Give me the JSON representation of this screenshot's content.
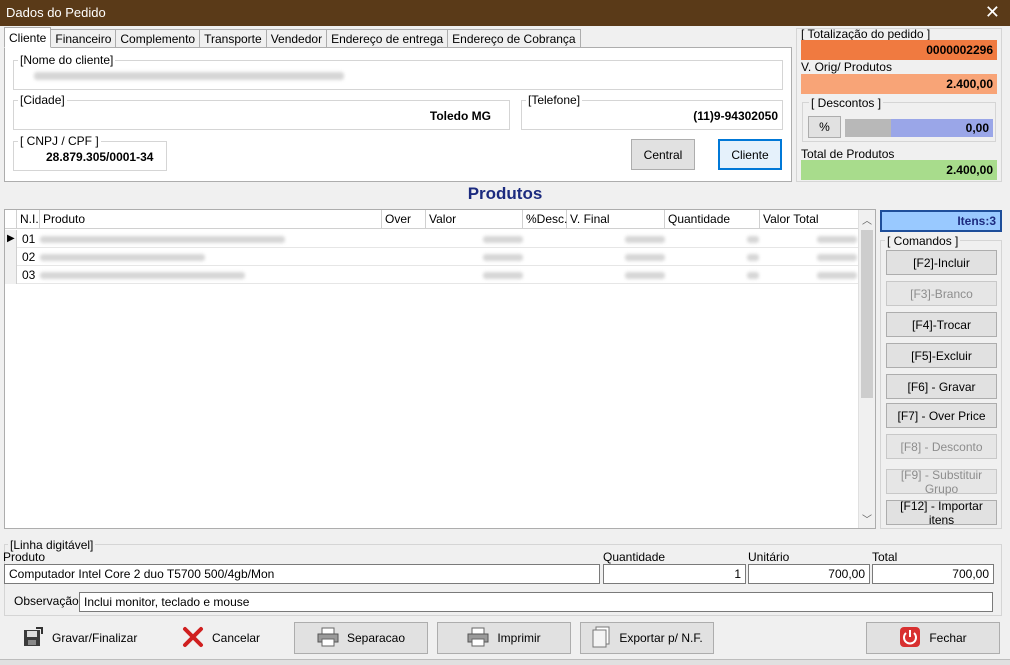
{
  "window": {
    "title": "Dados do Pedido",
    "close_glyph": "✕"
  },
  "tabs": [
    "Cliente",
    "Financeiro",
    "Complemento",
    "Transporte",
    "Vendedor",
    "Endereço de entrega",
    "Endereço de Cobrança"
  ],
  "cliente": {
    "nome_label": "[Nome do cliente]",
    "cidade_label": "[Cidade]",
    "cidade_value": "Toledo MG",
    "telefone_label": "[Telefone]",
    "telefone_value": "(11)9-94302050",
    "cnpj_label": "[ CNPJ / CPF  ]",
    "cnpj_value": "28.879.305/0001-34",
    "central_button": "Central",
    "cliente_button": "Cliente"
  },
  "totalizacao": {
    "title": "[ Totalização do pedido ]",
    "pedido_number": "0000002296",
    "orig_label": "V. Orig/ Produtos",
    "orig_value": "2.400,00",
    "descontos_label": "[ Descontos ]",
    "percent_button": "%",
    "desconto_value": "0,00",
    "total_label": "Total de Produtos",
    "total_value": "2.400,00",
    "colors": {
      "pedido": "#f07a40",
      "orig": "#f8a477",
      "total": "#a8dc8c",
      "desconto": "#9aa6e8"
    }
  },
  "produtos": {
    "title": "Produtos",
    "columns": [
      "N.I.",
      "Produto",
      "Over",
      "Valor",
      "%Desc.",
      "V. Final",
      "Quantidade",
      "Valor Total"
    ],
    "rows": [
      {
        "ni": "01"
      },
      {
        "ni": "02"
      },
      {
        "ni": "03"
      }
    ],
    "itens_label": "Itens:3"
  },
  "comandos": {
    "title": "[ Comandos ]",
    "buttons": [
      {
        "label": "[F2]-Incluir",
        "enabled": true
      },
      {
        "label": "[F3]-Branco",
        "enabled": false
      },
      {
        "label": "[F4]-Trocar",
        "enabled": true
      },
      {
        "label": "[F5]-Excluir",
        "enabled": true
      },
      {
        "label": "[F6] - Gravar",
        "enabled": true
      },
      {
        "label": "[F7]  - Over Price",
        "enabled": true
      },
      {
        "label": "[F8]  - Desconto",
        "enabled": false
      },
      {
        "label": "[F9] - Substituir Grupo",
        "enabled": false
      },
      {
        "label": "[F12] - Importar itens",
        "enabled": true
      }
    ]
  },
  "linha": {
    "title": "[Linha digitável]",
    "produto_label": "Produto",
    "produto_value": "Computador Intel Core 2 duo T5700 500/4gb/Mon",
    "quantidade_label": "Quantidade",
    "quantidade_value": "1",
    "unitario_label": "Unitário",
    "unitario_value": "700,00",
    "total_label": "Total",
    "total_value": "700,00",
    "obs_label": "Observação:",
    "obs_value": "Inclui monitor, teclado e mouse"
  },
  "footer": {
    "gravar": "Gravar/Finalizar",
    "cancelar": "Cancelar",
    "separacao": "Separacao",
    "imprimir": "Imprimir",
    "exportar": "Exportar p/ N.F.",
    "fechar": "Fechar"
  }
}
